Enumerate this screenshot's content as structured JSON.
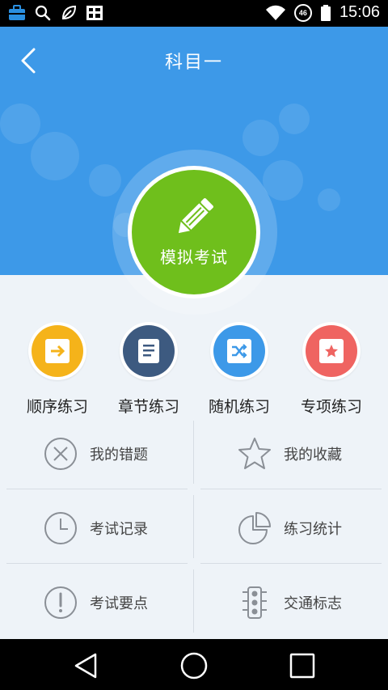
{
  "status_bar": {
    "time": "15:06",
    "network": "46",
    "left_icons": [
      "briefcase-icon",
      "search-icon",
      "leaf-icon",
      "grid-icon"
    ],
    "right_icons": [
      "wifi-icon",
      "network-badge-icon"
    ]
  },
  "header": {
    "title": "科目一",
    "background_color": "#3d99e8"
  },
  "exam_button": {
    "label": "模拟考试",
    "color": "#6fbf1c",
    "icon": "pencil-icon"
  },
  "practice_modes": [
    {
      "label": "顺序练习",
      "color": "#f5b31a",
      "icon": "arrow-right-icon"
    },
    {
      "label": "章节练习",
      "color": "#3d5a80",
      "icon": "document-icon"
    },
    {
      "label": "随机练习",
      "color": "#3d99e8",
      "icon": "shuffle-icon"
    },
    {
      "label": "专项练习",
      "color": "#ef6461",
      "icon": "star-icon"
    }
  ],
  "grid_items": [
    {
      "label": "我的错题",
      "icon": "x-circle-icon"
    },
    {
      "label": "我的收藏",
      "icon": "star-outline-icon"
    },
    {
      "label": "考试记录",
      "icon": "clock-icon"
    },
    {
      "label": "练习统计",
      "icon": "pie-chart-icon"
    },
    {
      "label": "考试要点",
      "icon": "exclamation-circle-icon"
    },
    {
      "label": "交通标志",
      "icon": "traffic-light-icon"
    }
  ],
  "nav_bar": {
    "buttons": [
      "back-triangle-icon",
      "home-circle-icon",
      "recents-square-icon"
    ]
  }
}
